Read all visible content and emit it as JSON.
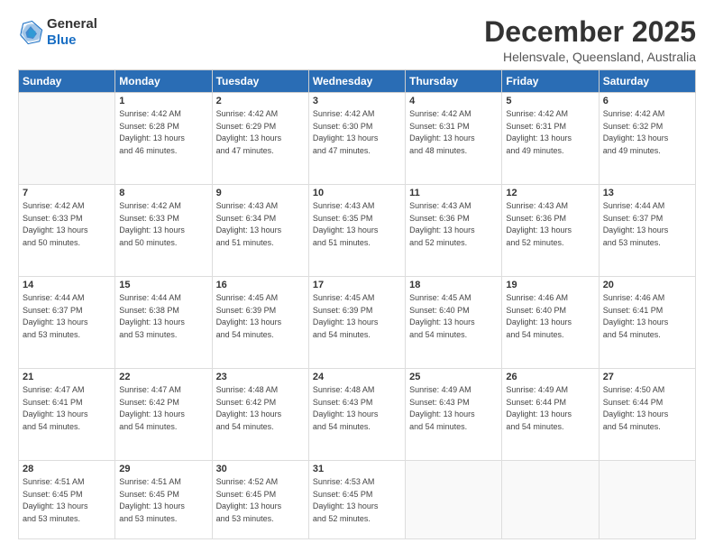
{
  "logo": {
    "line1": "General",
    "line2": "Blue"
  },
  "header": {
    "month": "December 2025",
    "location": "Helensvale, Queensland, Australia"
  },
  "weekdays": [
    "Sunday",
    "Monday",
    "Tuesday",
    "Wednesday",
    "Thursday",
    "Friday",
    "Saturday"
  ],
  "weeks": [
    [
      {
        "day": "",
        "info": ""
      },
      {
        "day": "1",
        "info": "Sunrise: 4:42 AM\nSunset: 6:28 PM\nDaylight: 13 hours\nand 46 minutes."
      },
      {
        "day": "2",
        "info": "Sunrise: 4:42 AM\nSunset: 6:29 PM\nDaylight: 13 hours\nand 47 minutes."
      },
      {
        "day": "3",
        "info": "Sunrise: 4:42 AM\nSunset: 6:30 PM\nDaylight: 13 hours\nand 47 minutes."
      },
      {
        "day": "4",
        "info": "Sunrise: 4:42 AM\nSunset: 6:31 PM\nDaylight: 13 hours\nand 48 minutes."
      },
      {
        "day": "5",
        "info": "Sunrise: 4:42 AM\nSunset: 6:31 PM\nDaylight: 13 hours\nand 49 minutes."
      },
      {
        "day": "6",
        "info": "Sunrise: 4:42 AM\nSunset: 6:32 PM\nDaylight: 13 hours\nand 49 minutes."
      }
    ],
    [
      {
        "day": "7",
        "info": "Sunrise: 4:42 AM\nSunset: 6:33 PM\nDaylight: 13 hours\nand 50 minutes."
      },
      {
        "day": "8",
        "info": "Sunrise: 4:42 AM\nSunset: 6:33 PM\nDaylight: 13 hours\nand 50 minutes."
      },
      {
        "day": "9",
        "info": "Sunrise: 4:43 AM\nSunset: 6:34 PM\nDaylight: 13 hours\nand 51 minutes."
      },
      {
        "day": "10",
        "info": "Sunrise: 4:43 AM\nSunset: 6:35 PM\nDaylight: 13 hours\nand 51 minutes."
      },
      {
        "day": "11",
        "info": "Sunrise: 4:43 AM\nSunset: 6:36 PM\nDaylight: 13 hours\nand 52 minutes."
      },
      {
        "day": "12",
        "info": "Sunrise: 4:43 AM\nSunset: 6:36 PM\nDaylight: 13 hours\nand 52 minutes."
      },
      {
        "day": "13",
        "info": "Sunrise: 4:44 AM\nSunset: 6:37 PM\nDaylight: 13 hours\nand 53 minutes."
      }
    ],
    [
      {
        "day": "14",
        "info": "Sunrise: 4:44 AM\nSunset: 6:37 PM\nDaylight: 13 hours\nand 53 minutes."
      },
      {
        "day": "15",
        "info": "Sunrise: 4:44 AM\nSunset: 6:38 PM\nDaylight: 13 hours\nand 53 minutes."
      },
      {
        "day": "16",
        "info": "Sunrise: 4:45 AM\nSunset: 6:39 PM\nDaylight: 13 hours\nand 54 minutes."
      },
      {
        "day": "17",
        "info": "Sunrise: 4:45 AM\nSunset: 6:39 PM\nDaylight: 13 hours\nand 54 minutes."
      },
      {
        "day": "18",
        "info": "Sunrise: 4:45 AM\nSunset: 6:40 PM\nDaylight: 13 hours\nand 54 minutes."
      },
      {
        "day": "19",
        "info": "Sunrise: 4:46 AM\nSunset: 6:40 PM\nDaylight: 13 hours\nand 54 minutes."
      },
      {
        "day": "20",
        "info": "Sunrise: 4:46 AM\nSunset: 6:41 PM\nDaylight: 13 hours\nand 54 minutes."
      }
    ],
    [
      {
        "day": "21",
        "info": "Sunrise: 4:47 AM\nSunset: 6:41 PM\nDaylight: 13 hours\nand 54 minutes."
      },
      {
        "day": "22",
        "info": "Sunrise: 4:47 AM\nSunset: 6:42 PM\nDaylight: 13 hours\nand 54 minutes."
      },
      {
        "day": "23",
        "info": "Sunrise: 4:48 AM\nSunset: 6:42 PM\nDaylight: 13 hours\nand 54 minutes."
      },
      {
        "day": "24",
        "info": "Sunrise: 4:48 AM\nSunset: 6:43 PM\nDaylight: 13 hours\nand 54 minutes."
      },
      {
        "day": "25",
        "info": "Sunrise: 4:49 AM\nSunset: 6:43 PM\nDaylight: 13 hours\nand 54 minutes."
      },
      {
        "day": "26",
        "info": "Sunrise: 4:49 AM\nSunset: 6:44 PM\nDaylight: 13 hours\nand 54 minutes."
      },
      {
        "day": "27",
        "info": "Sunrise: 4:50 AM\nSunset: 6:44 PM\nDaylight: 13 hours\nand 54 minutes."
      }
    ],
    [
      {
        "day": "28",
        "info": "Sunrise: 4:51 AM\nSunset: 6:45 PM\nDaylight: 13 hours\nand 53 minutes."
      },
      {
        "day": "29",
        "info": "Sunrise: 4:51 AM\nSunset: 6:45 PM\nDaylight: 13 hours\nand 53 minutes."
      },
      {
        "day": "30",
        "info": "Sunrise: 4:52 AM\nSunset: 6:45 PM\nDaylight: 13 hours\nand 53 minutes."
      },
      {
        "day": "31",
        "info": "Sunrise: 4:53 AM\nSunset: 6:45 PM\nDaylight: 13 hours\nand 52 minutes."
      },
      {
        "day": "",
        "info": ""
      },
      {
        "day": "",
        "info": ""
      },
      {
        "day": "",
        "info": ""
      }
    ]
  ]
}
